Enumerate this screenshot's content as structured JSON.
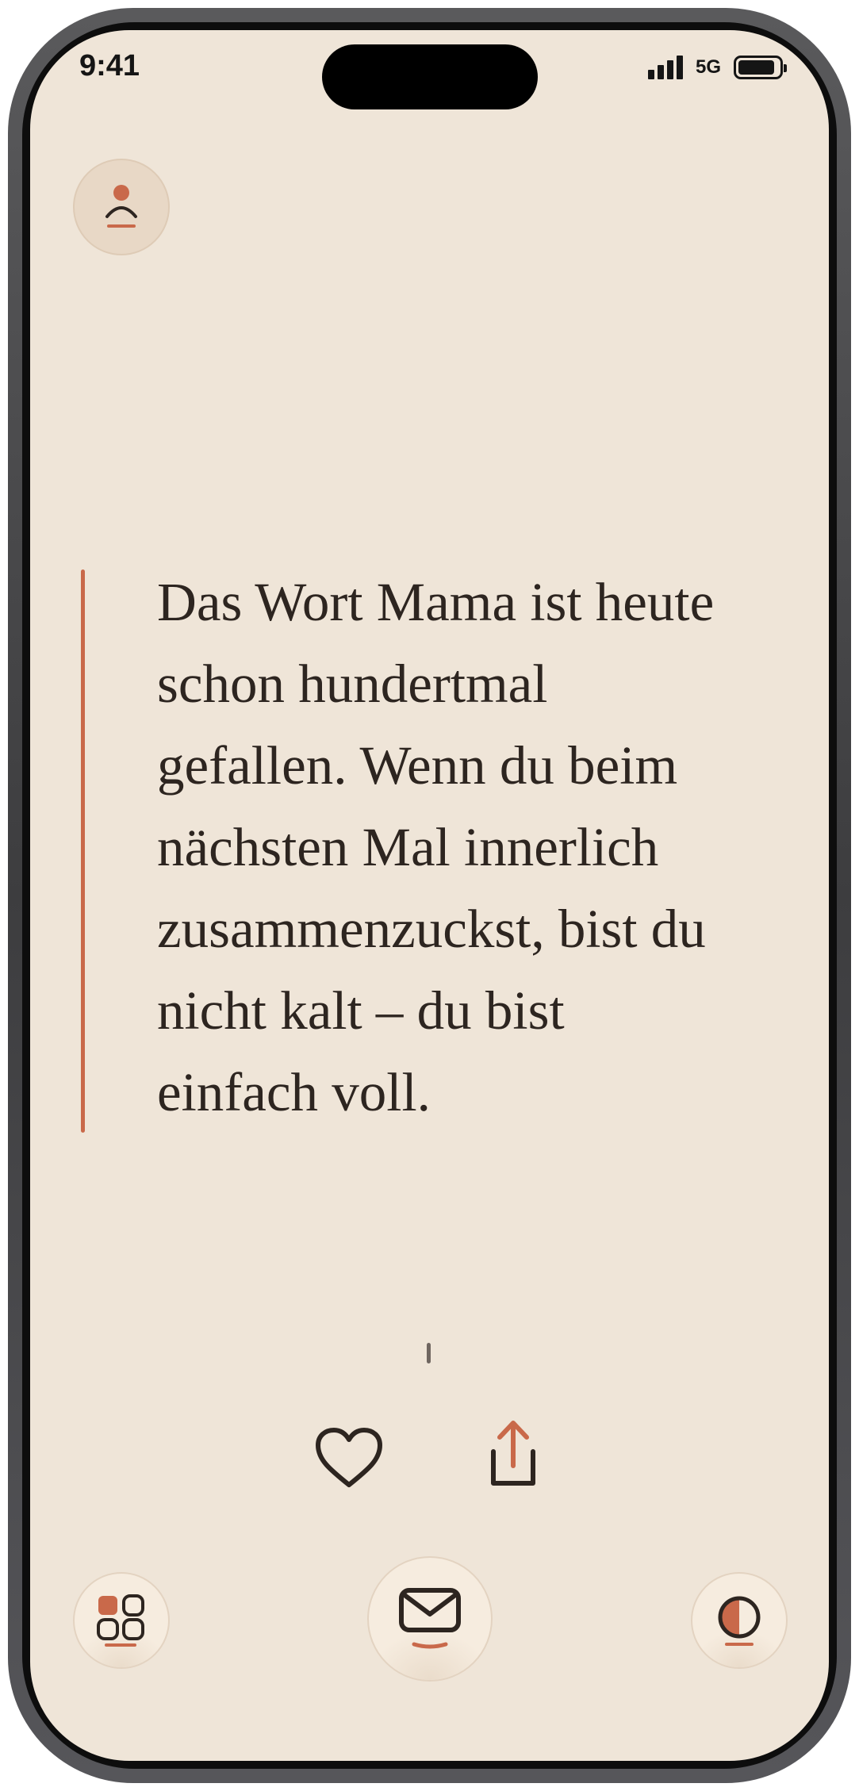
{
  "status_bar": {
    "time": "9:41",
    "network": "5G"
  },
  "quote": {
    "text": "Das Wort Mama ist heute schon hundertmal gefallen. Wenn du beim nächsten Mal innerlich zusammenzuckst, bist du nicht kalt – du bist einfach voll.",
    "lines": [
      "Das Wort Mama ist heute",
      "schon hundertmal",
      "gefallen. Wenn du beim",
      "nächsten Mal innerlich",
      "zusammenzuckst, bist du",
      "nicht kalt – du bist",
      "einfach voll."
    ]
  },
  "icons": {
    "profile": "person-icon",
    "like": "heart-icon",
    "share": "share-icon",
    "nav_left": "grid-icon",
    "nav_center": "mail-icon",
    "nav_right": "contrast-icon"
  },
  "colors": {
    "background": "#efe5d8",
    "accent": "#c9694a",
    "text": "#2d2520",
    "button_fill": "#f6ecdf"
  }
}
